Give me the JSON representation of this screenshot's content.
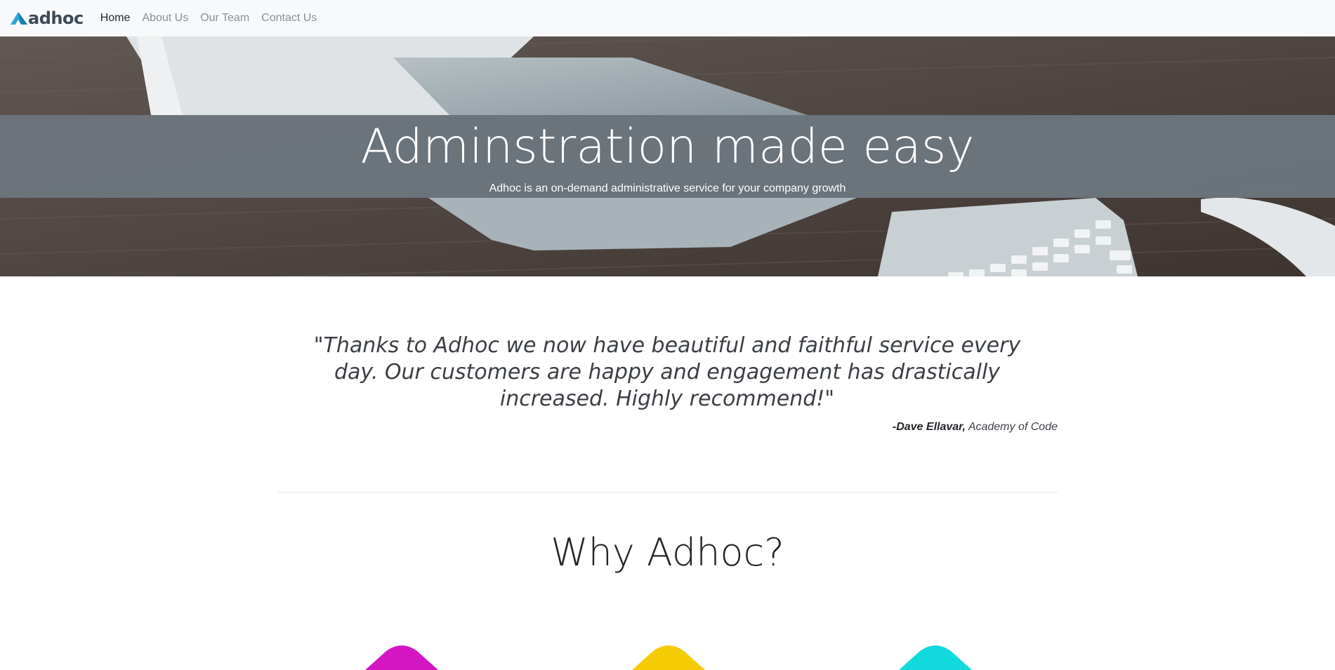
{
  "navbar": {
    "brand": "adhoc",
    "brand_icon": "mountain-logo-icon",
    "links": [
      {
        "label": "Home",
        "active": true
      },
      {
        "label": "About Us",
        "active": false
      },
      {
        "label": "Our Team",
        "active": false
      },
      {
        "label": "Contact Us",
        "active": false
      }
    ]
  },
  "hero": {
    "title": "Adminstration made easy",
    "subtitle": "Adhoc is an on-demand administrative service for your company growth"
  },
  "testimonial": {
    "quote": "\"Thanks to Adhoc we now have beautiful and faithful service every day. Our customers are happy and engagement has drastically increased. Highly recommend!\"",
    "author": "-Dave Ellavar,",
    "company": "Academy of Code"
  },
  "why": {
    "title": "Why Adhoc?"
  },
  "features": [
    {
      "icon": "magenta-shape-icon",
      "color": "#d316c2"
    },
    {
      "icon": "yellow-shape-icon",
      "color": "#f5cb05"
    },
    {
      "icon": "cyan-shape-icon",
      "color": "#12d9dc"
    }
  ],
  "colors": {
    "navbar_bg": "#f8f9fa",
    "hero_band": "#6c757d",
    "brand_accent": "#2fa7d8"
  }
}
